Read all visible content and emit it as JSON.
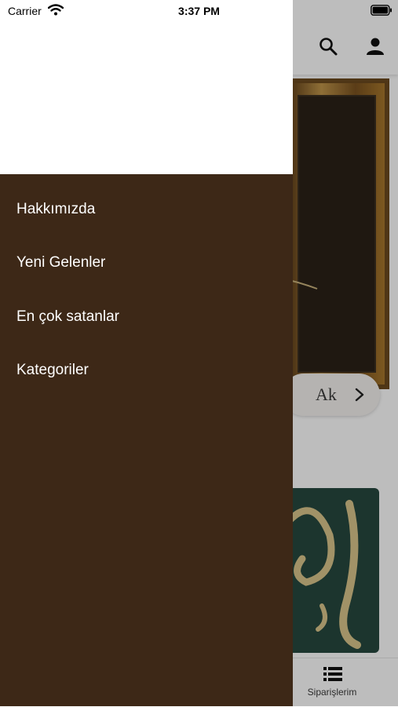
{
  "status_bar": {
    "carrier": "Carrier",
    "time": "3:37 PM"
  },
  "header": {
    "icons": [
      "search-icon",
      "profile-icon"
    ]
  },
  "content": {
    "slider_caption": "Ak"
  },
  "tab_bar": {
    "active_label": "Siparişlerim",
    "icon": "list-icon"
  },
  "drawer": {
    "items": [
      {
        "label": "Hakkımızda"
      },
      {
        "label": "Yeni Gelenler"
      },
      {
        "label": "En çok satanlar"
      },
      {
        "label": "Kategoriler"
      }
    ]
  },
  "colors": {
    "drawer_bg": "#3d2817",
    "drawer_header_bg": "#ffffff",
    "scrim": "rgba(0,0,0,0.26)",
    "frame_gold": "#a8782c"
  }
}
